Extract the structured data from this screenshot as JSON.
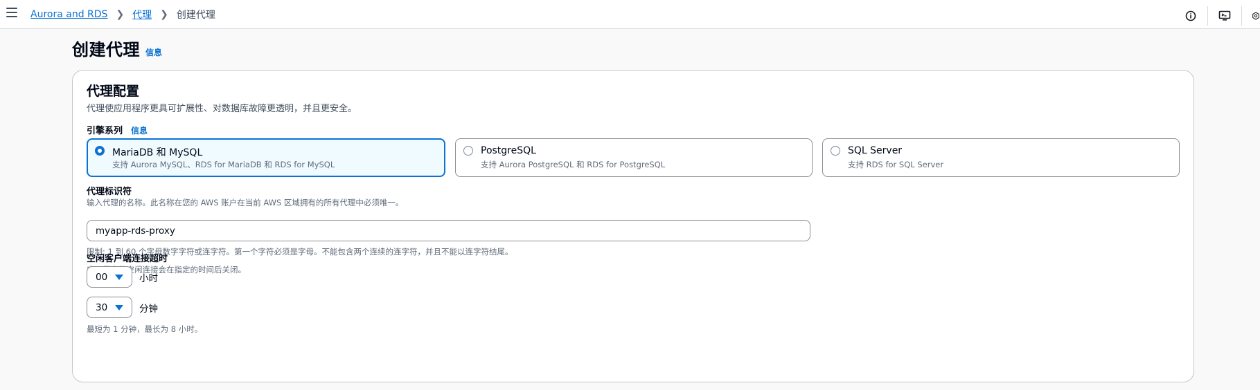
{
  "breadcrumb": {
    "items": [
      "Aurora and RDS",
      "代理"
    ],
    "current": "创建代理"
  },
  "page": {
    "title": "创建代理",
    "info": "信息"
  },
  "section": {
    "title": "代理配置",
    "description": "代理使应用程序更具可扩展性、对数据库故障更透明，并且更安全。"
  },
  "engine": {
    "label": "引擎系列",
    "info": "信息",
    "options": [
      {
        "title": "MariaDB 和 MySQL",
        "description": "支持 Aurora MySQL、RDS for MariaDB 和 RDS for MySQL",
        "selected": true
      },
      {
        "title": "PostgreSQL",
        "description": "支持 Aurora PostgreSQL 和 RDS for PostgreSQL",
        "selected": false
      },
      {
        "title": "SQL Server",
        "description": "支持 RDS for SQL Server",
        "selected": false
      }
    ]
  },
  "identifier": {
    "label": "代理标识符",
    "description": "输入代理的名称。此名称在您的 AWS 账户在当前 AWS 区域拥有的所有代理中必须唯一。",
    "value": "myapp-rds-proxy",
    "constraint": "限制: 1 到 60 个字母数字字符或连字符。第一个字符必须是字母。不能包含两个连续的连字符，并且不能以连字符结尾。"
  },
  "timeout": {
    "label": "空闲客户端连接超时",
    "description": "应用程序的空闲连接会在指定的时间后关闭。",
    "hours_value": "00",
    "hours_unit": "小时",
    "minutes_value": "30",
    "minutes_unit": "分钟",
    "constraint": "最短为 1 分钟，最长为 8 小时。"
  },
  "colors": {
    "link": "#0972d3",
    "selected_bg": "#f0fbff",
    "text": "#000716",
    "muted": "#5f6b7a"
  },
  "icons": [
    "hamburger-icon",
    "chevron-right-icon",
    "info-circle-icon",
    "cloudshell-icon",
    "settings-hex-icon"
  ]
}
